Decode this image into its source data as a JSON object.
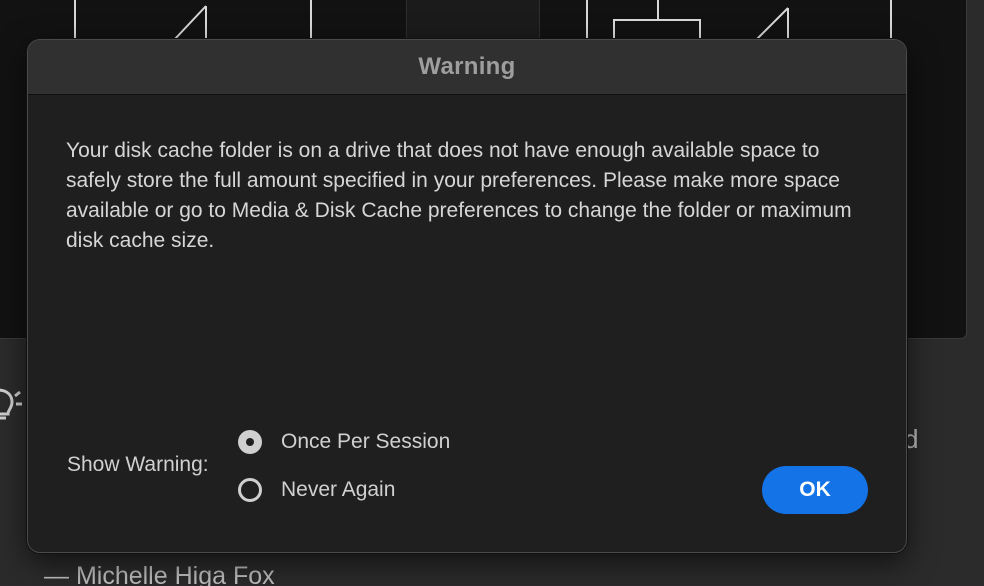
{
  "background": {
    "author_line": "— Michelle Higa Fox",
    "partial_text": "d"
  },
  "dialog": {
    "title": "Warning",
    "message": "Your disk cache folder is on a drive that does not have enough available space to safely store the full amount specified in your preferences. Please make more space available or go to Media & Disk Cache preferences to change the folder or maximum disk cache size.",
    "show_warning_label": "Show Warning:",
    "options": [
      {
        "label": "Once Per Session",
        "selected": true
      },
      {
        "label": "Never Again",
        "selected": false
      }
    ],
    "ok_label": "OK",
    "accent_color": "#1473e6"
  }
}
